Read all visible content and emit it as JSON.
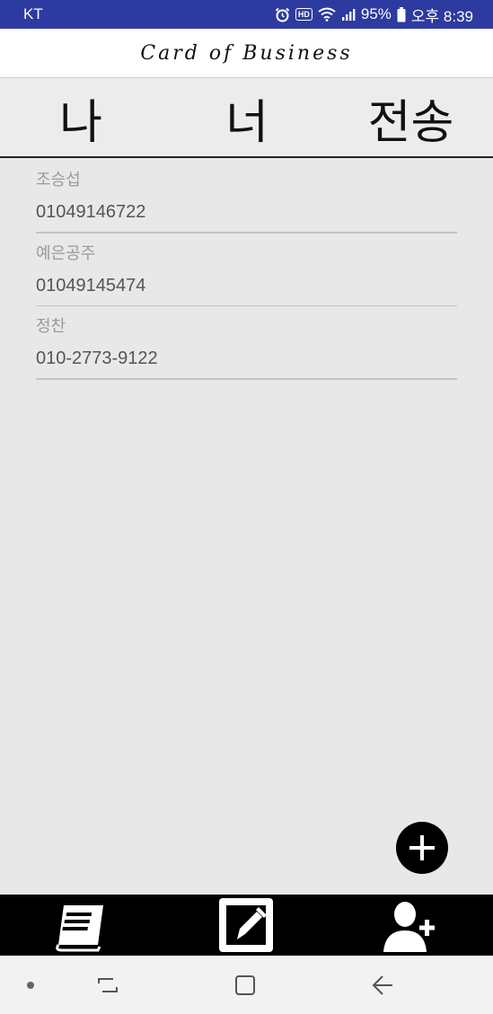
{
  "status_bar": {
    "carrier": "KT",
    "hd_label": "HD",
    "battery": "95%",
    "time": "오후 8:39"
  },
  "app": {
    "title": "Card of Business"
  },
  "tabs": [
    {
      "label": "나"
    },
    {
      "label": "너"
    },
    {
      "label": "전송"
    }
  ],
  "contacts": [
    {
      "name": "조승섭",
      "phone": "01049146722"
    },
    {
      "name": "예은공주",
      "phone": "01049145474"
    },
    {
      "name": "정찬",
      "phone": "010-2773-9122"
    }
  ],
  "fab": {
    "icon": "plus-icon"
  },
  "bottom_nav": {
    "items": [
      {
        "icon": "book-icon"
      },
      {
        "icon": "edit-icon"
      },
      {
        "icon": "add-person-icon"
      }
    ]
  },
  "system_nav": {
    "items": [
      {
        "icon": "dot-icon"
      },
      {
        "icon": "recents-icon"
      },
      {
        "icon": "home-icon"
      },
      {
        "icon": "back-icon"
      }
    ]
  },
  "colors": {
    "status_bar": "#2d3aa0",
    "background": "#e8e8e8",
    "nav_bar": "#000000"
  }
}
